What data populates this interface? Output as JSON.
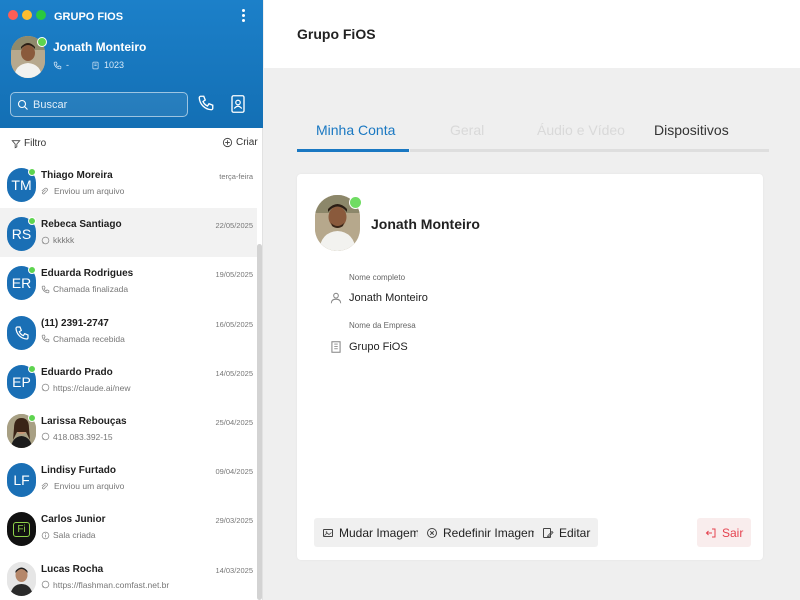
{
  "app": {
    "title": "GRUPO FIOS"
  },
  "user": {
    "name": "Jonath Monteiro",
    "phone": "-",
    "extension": "1023"
  },
  "search": {
    "placeholder": "Buscar"
  },
  "filter": {
    "label": "Filtro",
    "create_label": "Criar"
  },
  "chats": [
    {
      "initials": "TM",
      "name": "Thiago Moreira",
      "date": "terça-feira",
      "last": "Enviou um arquivo",
      "icon": "file-icon",
      "online": true
    },
    {
      "initials": "RS",
      "name": "Rebeca Santiago",
      "date": "22/05/2025",
      "last": "kkkkk",
      "icon": "chat-bubble-icon",
      "online": true,
      "active": true
    },
    {
      "initials": "ER",
      "name": "Eduarda Rodrigues",
      "date": "19/05/2025",
      "last": "Chamada finalizada",
      "icon": "phone-icon",
      "online": true
    },
    {
      "initials": "",
      "name": "(11) 2391-2747",
      "date": "16/05/2025",
      "last": "Chamada recebida",
      "icon": "phone-incoming-icon",
      "online": false
    },
    {
      "initials": "EP",
      "name": "Eduardo Prado",
      "date": "14/05/2025",
      "last": "https://claude.ai/new",
      "icon": "chat-bubble-icon",
      "online": true
    },
    {
      "initials": "",
      "name": "Larissa Rebouças",
      "date": "25/04/2025",
      "last": "418.083.392-15",
      "icon": "chat-bubble-icon",
      "online": true
    },
    {
      "initials": "LF",
      "name": "Lindisy Furtado",
      "date": "09/04/2025",
      "last": "Enviou um arquivo",
      "icon": "file-icon",
      "online": false
    },
    {
      "initials": "Fi",
      "name": "Carlos Junior",
      "date": "29/03/2025",
      "last": "Sala criada",
      "icon": "info-icon",
      "online": false
    },
    {
      "initials": "",
      "name": "Lucas Rocha",
      "date": "14/03/2025",
      "last": "https://flashman.comfast.net.br",
      "icon": "chat-bubble-icon",
      "online": false
    }
  ],
  "main": {
    "group_title": "Grupo FiOS",
    "tabs": [
      "Minha Conta",
      "Geral",
      "Áudio e Vídeo",
      "Dispositivos"
    ],
    "active_tab": "Minha Conta"
  },
  "profile": {
    "name": "Jonath Monteiro",
    "full_name_label": "Nome completo",
    "full_name": "Jonath Monteiro",
    "company_label": "Nome da Empresa",
    "company": "Grupo FiOS"
  },
  "actions": {
    "change_image": "Mudar Imagem",
    "reset_image": "Redefinir Imagem",
    "edit": "Editar",
    "logout": "Sair"
  },
  "colors": {
    "brand": "#1a78c2",
    "online": "#5ed44f",
    "danger": "#e54350"
  }
}
